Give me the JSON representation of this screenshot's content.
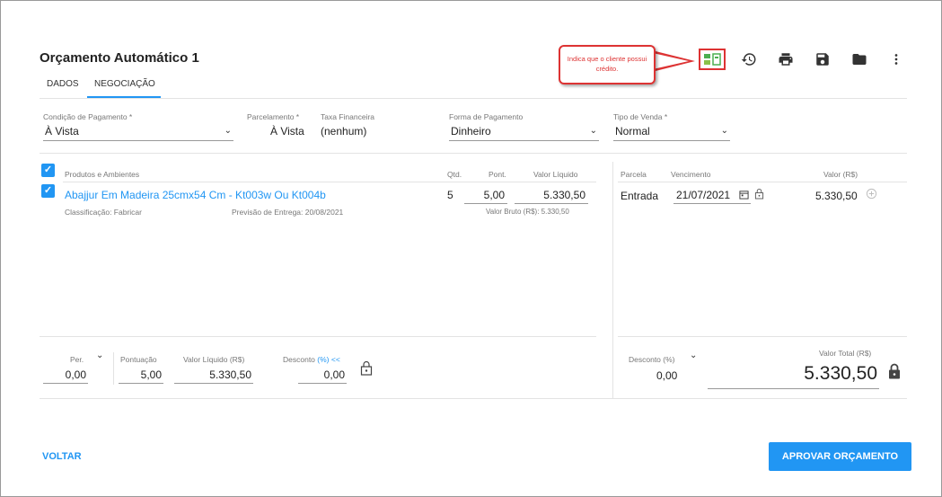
{
  "page": {
    "title": "Orçamento Automático 1"
  },
  "tabs": [
    {
      "label": "DADOS"
    },
    {
      "label": "NEGOCIAÇÃO",
      "active": true
    }
  ],
  "toolbar": {
    "tooltip": "Indica que o cliente possui crédito.",
    "icons": [
      "credit-icon",
      "history-icon",
      "print-icon",
      "save-icon",
      "folder-icon",
      "more-vert-icon"
    ]
  },
  "form": {
    "condicao": {
      "label": "Condição de Pagamento *",
      "value": "À Vista"
    },
    "parcelamento": {
      "label": "Parcelamento *",
      "value": "À Vista"
    },
    "taxa": {
      "label": "Taxa Financeira",
      "value": "(nenhum)"
    },
    "forma": {
      "label": "Forma de Pagamento",
      "value": "Dinheiro"
    },
    "tipo": {
      "label": "Tipo de Venda *",
      "value": "Normal"
    }
  },
  "products": {
    "headers": {
      "produtos": "Produtos e Ambientes",
      "qtd": "Qtd.",
      "pont": "Pont.",
      "valor": "Valor Líquido"
    },
    "items": [
      {
        "name": "Abajjur Em Madeira 25cmx54 Cm - Kt003w Ou Kt004b",
        "classificacao": "Classificação: Fabricar",
        "previsao": "Previsão de Entrega: 20/08/2021",
        "qtd": "5",
        "pont": "5,00",
        "valor": "5.330,50",
        "valor_bruto": "Valor Bruto (R$): 5.330,50"
      }
    ]
  },
  "parcelas": {
    "headers": {
      "parcela": "Parcela",
      "vencimento": "Vencimento",
      "valor": "Valor (R$)"
    },
    "rows": [
      {
        "parcela": "Entrada",
        "vencimento": "21/07/2021",
        "valor": "5.330,50"
      }
    ]
  },
  "summary": {
    "per": {
      "label": "Per.",
      "value": "0,00"
    },
    "pontuacao": {
      "label": "Pontuação",
      "value": "5,00"
    },
    "valor_liquido": {
      "label": "Valor Líquido (R$)",
      "value": "5.330,50"
    },
    "desconto": {
      "label": "Desconto",
      "label_accent": "(%) <<",
      "value": "0,00"
    },
    "desconto_pct": {
      "label": "Desconto (%)",
      "value": "0,00"
    },
    "valor_total": {
      "label": "Valor Total (R$)",
      "value": "5.330,50"
    }
  },
  "actions": {
    "voltar": "VOLTAR",
    "aprovar": "APROVAR ORÇAMENTO"
  },
  "colors": {
    "accent": "#2196f3",
    "highlight": "#dd3333",
    "credit": "#4caf50"
  }
}
